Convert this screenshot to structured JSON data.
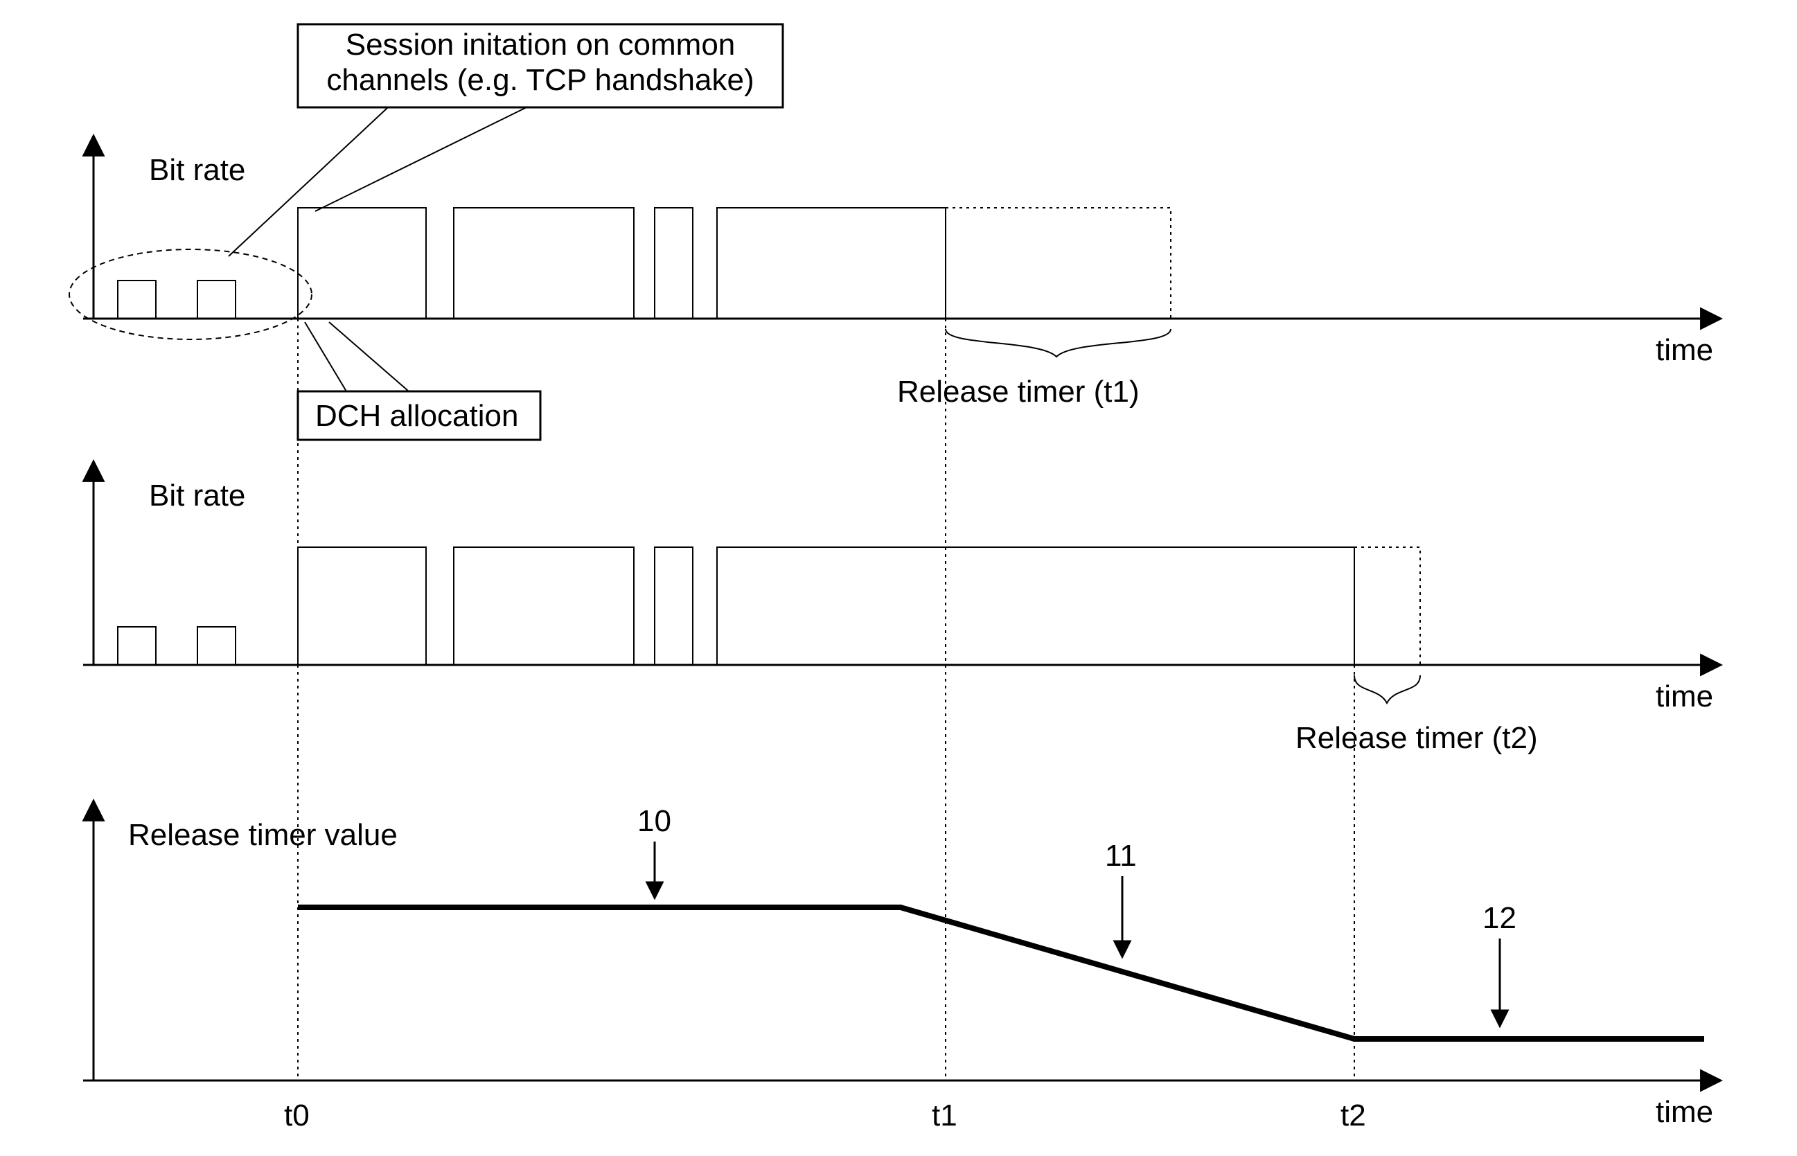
{
  "callouts": {
    "session_init": "Session initation on common\nchannels (e.g. TCP handshake)",
    "dch_allocation": "DCH allocation"
  },
  "labels": {
    "bit_rate_1": "Bit rate",
    "bit_rate_2": "Bit rate",
    "release_timer_1": "Release timer (t1)",
    "release_timer_2": "Release timer (t2)",
    "release_timer_value": "Release timer value",
    "time_1": "time",
    "time_2": "time",
    "time_3": "time",
    "t0": "t0",
    "t1": "t1",
    "t2": "t2"
  },
  "pointers": {
    "p10": "10",
    "p11": "11",
    "p12": "12"
  },
  "chart_data": {
    "type": "diagram",
    "description": "Three stacked time-axis plots illustrating DCH allocation and a release-timer whose value decreases from t1 to t2.",
    "time_marks": [
      "t0",
      "t1",
      "t2"
    ],
    "plots": [
      {
        "name": "bit_rate_session_t1",
        "ylabel": "Bit rate",
        "pre_dch_pulses": 2,
        "dch_blocks": 4,
        "dch_end_at": "last block ends, then release timer t1 window (dotted) extends to right",
        "release_timer_span": "t1"
      },
      {
        "name": "bit_rate_session_t2",
        "ylabel": "Bit rate",
        "pre_dch_pulses": 2,
        "dch_blocks": 4,
        "dch_end_at": "last block extends further right, release timer t2 window is short",
        "release_timer_span": "t2"
      },
      {
        "name": "release_timer_value",
        "ylabel": "Release timer value",
        "piecewise": [
          {
            "from": "t0",
            "to": "t1",
            "shape": "constant-high",
            "pointer": "10"
          },
          {
            "from": "t1",
            "to": "t2",
            "shape": "linear-decreasing",
            "pointer": "11"
          },
          {
            "from": "t2",
            "to": "end",
            "shape": "constant-low",
            "pointer": "12"
          }
        ]
      }
    ]
  }
}
